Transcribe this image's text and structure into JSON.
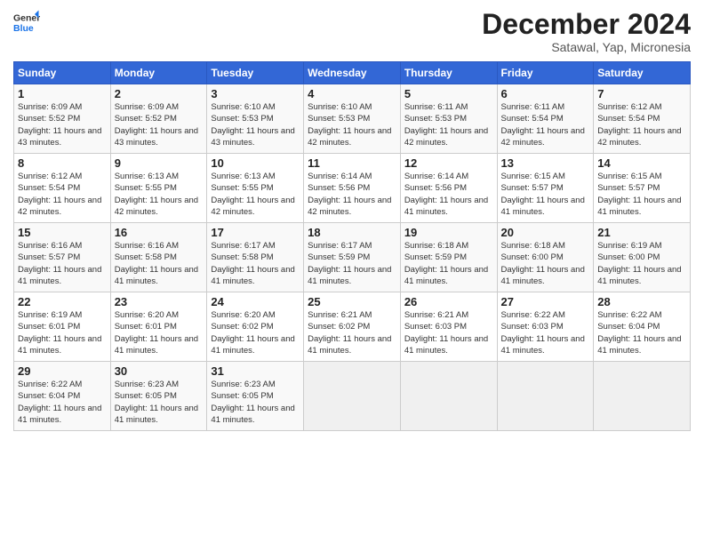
{
  "header": {
    "logo_line1": "General",
    "logo_line2": "Blue",
    "month": "December 2024",
    "location": "Satawal, Yap, Micronesia"
  },
  "weekdays": [
    "Sunday",
    "Monday",
    "Tuesday",
    "Wednesday",
    "Thursday",
    "Friday",
    "Saturday"
  ],
  "weeks": [
    [
      {
        "day": "1",
        "sunrise": "6:09 AM",
        "sunset": "5:52 PM",
        "daylight": "11 hours and 43 minutes."
      },
      {
        "day": "2",
        "sunrise": "6:09 AM",
        "sunset": "5:52 PM",
        "daylight": "11 hours and 43 minutes."
      },
      {
        "day": "3",
        "sunrise": "6:10 AM",
        "sunset": "5:53 PM",
        "daylight": "11 hours and 43 minutes."
      },
      {
        "day": "4",
        "sunrise": "6:10 AM",
        "sunset": "5:53 PM",
        "daylight": "11 hours and 42 minutes."
      },
      {
        "day": "5",
        "sunrise": "6:11 AM",
        "sunset": "5:53 PM",
        "daylight": "11 hours and 42 minutes."
      },
      {
        "day": "6",
        "sunrise": "6:11 AM",
        "sunset": "5:54 PM",
        "daylight": "11 hours and 42 minutes."
      },
      {
        "day": "7",
        "sunrise": "6:12 AM",
        "sunset": "5:54 PM",
        "daylight": "11 hours and 42 minutes."
      }
    ],
    [
      {
        "day": "8",
        "sunrise": "6:12 AM",
        "sunset": "5:54 PM",
        "daylight": "11 hours and 42 minutes."
      },
      {
        "day": "9",
        "sunrise": "6:13 AM",
        "sunset": "5:55 PM",
        "daylight": "11 hours and 42 minutes."
      },
      {
        "day": "10",
        "sunrise": "6:13 AM",
        "sunset": "5:55 PM",
        "daylight": "11 hours and 42 minutes."
      },
      {
        "day": "11",
        "sunrise": "6:14 AM",
        "sunset": "5:56 PM",
        "daylight": "11 hours and 42 minutes."
      },
      {
        "day": "12",
        "sunrise": "6:14 AM",
        "sunset": "5:56 PM",
        "daylight": "11 hours and 41 minutes."
      },
      {
        "day": "13",
        "sunrise": "6:15 AM",
        "sunset": "5:57 PM",
        "daylight": "11 hours and 41 minutes."
      },
      {
        "day": "14",
        "sunrise": "6:15 AM",
        "sunset": "5:57 PM",
        "daylight": "11 hours and 41 minutes."
      }
    ],
    [
      {
        "day": "15",
        "sunrise": "6:16 AM",
        "sunset": "5:57 PM",
        "daylight": "11 hours and 41 minutes."
      },
      {
        "day": "16",
        "sunrise": "6:16 AM",
        "sunset": "5:58 PM",
        "daylight": "11 hours and 41 minutes."
      },
      {
        "day": "17",
        "sunrise": "6:17 AM",
        "sunset": "5:58 PM",
        "daylight": "11 hours and 41 minutes."
      },
      {
        "day": "18",
        "sunrise": "6:17 AM",
        "sunset": "5:59 PM",
        "daylight": "11 hours and 41 minutes."
      },
      {
        "day": "19",
        "sunrise": "6:18 AM",
        "sunset": "5:59 PM",
        "daylight": "11 hours and 41 minutes."
      },
      {
        "day": "20",
        "sunrise": "6:18 AM",
        "sunset": "6:00 PM",
        "daylight": "11 hours and 41 minutes."
      },
      {
        "day": "21",
        "sunrise": "6:19 AM",
        "sunset": "6:00 PM",
        "daylight": "11 hours and 41 minutes."
      }
    ],
    [
      {
        "day": "22",
        "sunrise": "6:19 AM",
        "sunset": "6:01 PM",
        "daylight": "11 hours and 41 minutes."
      },
      {
        "day": "23",
        "sunrise": "6:20 AM",
        "sunset": "6:01 PM",
        "daylight": "11 hours and 41 minutes."
      },
      {
        "day": "24",
        "sunrise": "6:20 AM",
        "sunset": "6:02 PM",
        "daylight": "11 hours and 41 minutes."
      },
      {
        "day": "25",
        "sunrise": "6:21 AM",
        "sunset": "6:02 PM",
        "daylight": "11 hours and 41 minutes."
      },
      {
        "day": "26",
        "sunrise": "6:21 AM",
        "sunset": "6:03 PM",
        "daylight": "11 hours and 41 minutes."
      },
      {
        "day": "27",
        "sunrise": "6:22 AM",
        "sunset": "6:03 PM",
        "daylight": "11 hours and 41 minutes."
      },
      {
        "day": "28",
        "sunrise": "6:22 AM",
        "sunset": "6:04 PM",
        "daylight": "11 hours and 41 minutes."
      }
    ],
    [
      {
        "day": "29",
        "sunrise": "6:22 AM",
        "sunset": "6:04 PM",
        "daylight": "11 hours and 41 minutes."
      },
      {
        "day": "30",
        "sunrise": "6:23 AM",
        "sunset": "6:05 PM",
        "daylight": "11 hours and 41 minutes."
      },
      {
        "day": "31",
        "sunrise": "6:23 AM",
        "sunset": "6:05 PM",
        "daylight": "11 hours and 41 minutes."
      },
      null,
      null,
      null,
      null
    ]
  ]
}
